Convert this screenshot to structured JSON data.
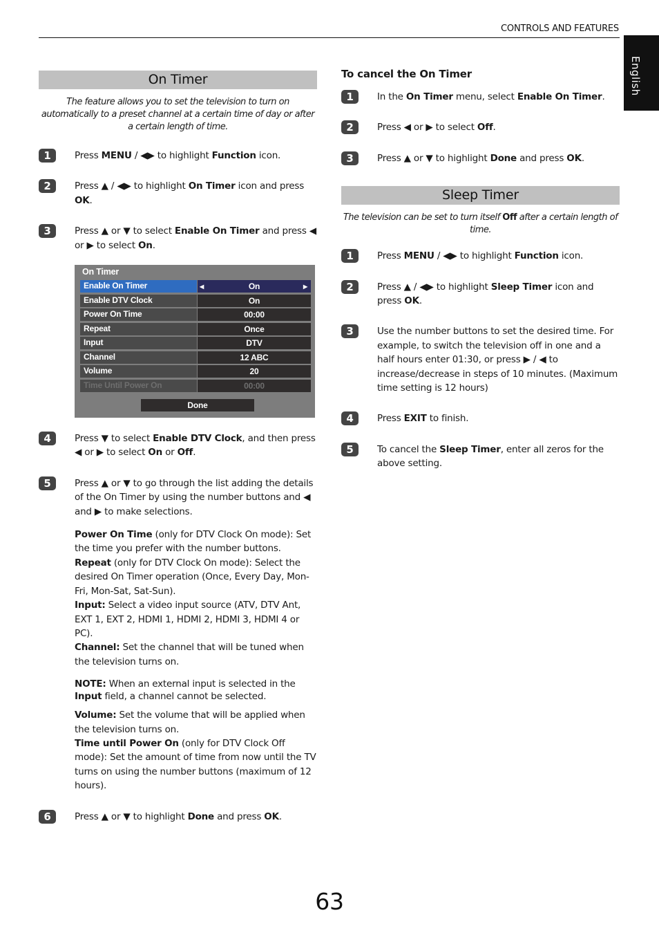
{
  "header": {
    "section_title": "CONTROLS AND FEATURES",
    "language_tab": "English"
  },
  "on_timer": {
    "title": "On Timer",
    "intro": "The feature allows you to set the television to turn on automatically to a preset channel at a certain time of day or after a certain length of time.",
    "steps": [
      {
        "num": "1",
        "html_parts": [
          "Press ",
          "MENU",
          " / ◀▶ to highlight ",
          "Function",
          " icon."
        ]
      },
      {
        "num": "2",
        "html_parts": [
          "Press ▲ / ◀▶ to highlight ",
          "On Timer",
          " icon and press ",
          "OK",
          "."
        ]
      },
      {
        "num": "3",
        "html_parts": [
          "Press ▲ or ▼ to select ",
          "Enable On Timer",
          " and press ◀ or ▶ to select ",
          "On",
          "."
        ]
      },
      {
        "num": "4",
        "html_parts": [
          "Press ▼ to select ",
          "Enable DTV Clock",
          ", and then press ◀ or ▶ to select ",
          "On",
          " or ",
          "Off",
          "."
        ]
      },
      {
        "num": "5",
        "html_parts": [
          "Press ▲ or ▼ to go through the list adding the details of the On Timer by using the number buttons and ◀ and ▶ to make selections."
        ]
      },
      {
        "num": "6",
        "html_parts": [
          "Press ▲ or ▼ to highlight ",
          "Done",
          " and press ",
          "OK",
          "."
        ]
      }
    ],
    "details": [
      {
        "term": "Power On Time",
        "text": " (only for DTV Clock On mode): Set the time you prefer with the number buttons."
      },
      {
        "term": "Repeat",
        "text": " (only for DTV Clock On mode): Select the desired On Timer operation (Once, Every Day, Mon-Fri, Mon-Sat, Sat-Sun)."
      },
      {
        "term": "Input:",
        "text": " Select a video input source (ATV, DTV Ant, EXT 1, EXT 2, HDMI 1, HDMI 2, HDMI 3, HDMI 4 or PC)."
      },
      {
        "term": "Channel:",
        "text": " Set the channel that will be tuned when the television turns on."
      }
    ],
    "note": {
      "term": "NOTE:",
      "text": " When an external input is selected in the ",
      "term2": "Input",
      "text2": " field, a channel cannot be selected."
    },
    "details2": [
      {
        "term": "Volume:",
        "text": " Set the volume that will be applied when the television turns on."
      },
      {
        "term": "Time until Power On",
        "text": " (only for DTV Clock Off mode): Set the amount of time from now until the TV turns on using the number buttons (maximum of 12 hours)."
      }
    ],
    "osd": {
      "title": "On Timer",
      "rows": [
        {
          "label": "Enable On Timer",
          "value": "On"
        },
        {
          "label": "Enable DTV Clock",
          "value": "On"
        },
        {
          "label": "Power On Time",
          "value": "00:00"
        },
        {
          "label": "Repeat",
          "value": "Once"
        },
        {
          "label": "Input",
          "value": "DTV"
        },
        {
          "label": "Channel",
          "value": "12 ABC"
        },
        {
          "label": "Volume",
          "value": "20"
        },
        {
          "label": "Time Until Power On",
          "value": "00:00"
        }
      ],
      "done_label": "Done"
    }
  },
  "cancel_on_timer": {
    "title": "To cancel the On Timer",
    "steps": [
      {
        "num": "1",
        "html_parts": [
          "In the ",
          "On Timer",
          " menu, select ",
          "Enable On Timer",
          "."
        ]
      },
      {
        "num": "2",
        "html_parts": [
          "Press ◀ or ▶ to select ",
          "Off",
          "."
        ]
      },
      {
        "num": "3",
        "html_parts": [
          "Press ▲ or ▼ to highlight ",
          "Done",
          " and press ",
          "OK",
          "."
        ]
      }
    ]
  },
  "sleep_timer": {
    "title": "Sleep Timer",
    "intro_a": "The television can be set to turn itself ",
    "intro_bold": "Off",
    "intro_b": " after a certain length of time.",
    "steps": [
      {
        "num": "1",
        "html_parts": [
          "Press ",
          "MENU",
          " / ◀▶ to highlight ",
          "Function",
          " icon."
        ]
      },
      {
        "num": "2",
        "html_parts": [
          "Press ▲ / ◀▶ to highlight ",
          "Sleep Timer",
          " icon and press ",
          "OK",
          "."
        ]
      },
      {
        "num": "3",
        "html_parts": [
          "Use the number buttons to set the desired time. For example, to switch the television off in one and a half hours enter 01:30, or press ▶ / ◀ to increase/decrease in steps of 10 minutes. (Maximum time setting is 12 hours)"
        ]
      },
      {
        "num": "4",
        "html_parts": [
          "Press ",
          "EXIT",
          " to finish."
        ]
      },
      {
        "num": "5",
        "html_parts": [
          "To cancel the ",
          "Sleep Timer",
          ", enter all zeros for the above setting."
        ]
      }
    ]
  },
  "page_number": "63"
}
